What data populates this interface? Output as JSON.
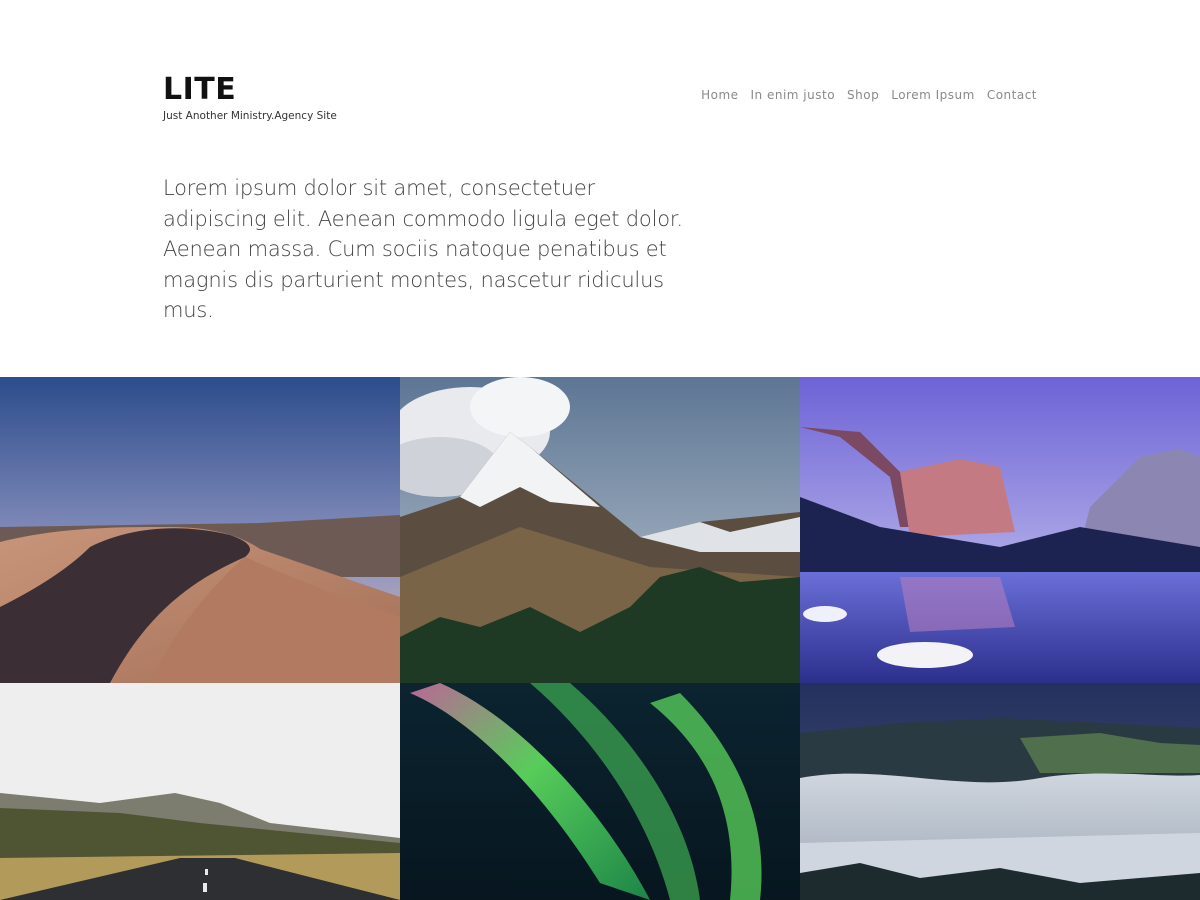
{
  "site": {
    "title": "LITE",
    "tagline": "Just Another Ministry.Agency Site"
  },
  "nav": {
    "items": [
      {
        "label": "Home"
      },
      {
        "label": "In enim justo"
      },
      {
        "label": "Shop"
      },
      {
        "label": "Lorem Ipsum"
      },
      {
        "label": "Contact"
      }
    ]
  },
  "intro": {
    "text": "Lorem ipsum dolor sit amet, consectetuer adipiscing elit. Aenean commodo ligula eget dolor. Aenean massa. Cum sociis natoque penatibus et magnis dis parturient montes, nascetur ridiculus mus."
  },
  "gallery": {
    "images": [
      {
        "subject": "desert-dunes-photo"
      },
      {
        "subject": "snowy-mountain-peak-photo"
      },
      {
        "subject": "mountain-lake-reflection-photo"
      },
      {
        "subject": "highway-hills-photo"
      },
      {
        "subject": "aurora-borealis-photo"
      },
      {
        "subject": "foggy-forest-valley-photo"
      }
    ]
  },
  "colors": {
    "text": "#111111",
    "nav": "#8a8a8a",
    "intro": "#444444",
    "background": "#ffffff"
  }
}
